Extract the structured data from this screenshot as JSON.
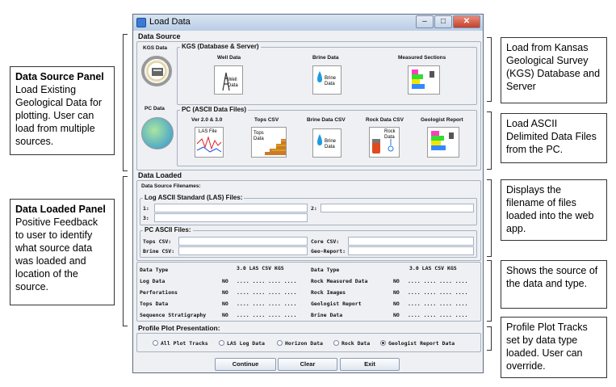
{
  "window": {
    "title": "Load Data"
  },
  "callouts": {
    "source_panel": {
      "title": "Data Source Panel",
      "body": "Load Existing Geological Data for plotting. User can load from multiple sources."
    },
    "loaded_panel": {
      "title": "Data Loaded Panel",
      "body": "Positive Feedback to user to identify what source data was loaded and location of the source."
    },
    "kgs": "Load from Kansas Geological Survey (KGS) Database and Server",
    "ascii": "Load ASCII Delimited Data Files from the PC.",
    "filenames": "Displays the filename of files loaded into the web app.",
    "source_type": "Shows the source of the data and type.",
    "tracks": "Profile Plot Tracks set by data type loaded. User can override."
  },
  "data_source": {
    "title": "Data Source",
    "kgs_label": "KGS Data",
    "kgs_group": "KGS (Database & Server)",
    "kgs_items": [
      {
        "label": "Well Data",
        "icon_text": "Well Data",
        "icon": "well-data-icon"
      },
      {
        "label": "Brine Data",
        "icon_text": "Brine Data",
        "icon": "brine-data-icon"
      },
      {
        "label": "Measured Sections",
        "icon_text": "",
        "icon": "measured-sections-icon"
      }
    ],
    "pc_label": "PC Data",
    "pc_group": "PC (ASCII Data Files)",
    "pc_items": [
      {
        "label": "Ver 2.0 & 3.0",
        "icon_text": "LAS File",
        "icon": "las-file-icon"
      },
      {
        "label": "Tops CSV",
        "icon_text": "Tops Data",
        "icon": "tops-data-icon"
      },
      {
        "label": "Brine Data CSV",
        "icon_text": "Brine Data",
        "icon": "brine-csv-icon"
      },
      {
        "label": "Rock Data CSV",
        "icon_text": "Rock Data",
        "icon": "rock-data-icon"
      },
      {
        "label": "Geologist Report",
        "icon_text": "",
        "icon": "geologist-report-icon"
      }
    ]
  },
  "data_loaded": {
    "title": "Data Loaded",
    "filenames_title": "Data Source Filenames:",
    "las_group": "Log ASCII Standard (LAS) Files:",
    "las_labels": [
      "1:",
      "2:",
      "3:"
    ],
    "pc_group": "PC ASCII Files:",
    "pc_labels": [
      "Tops CSV:",
      "Core CSV:",
      "Brine CSV:",
      "Geo-Report:"
    ]
  },
  "table": {
    "header_left": "Data Type",
    "header_right": "Data Type",
    "cols": "3.0  LAS  CSV  KGS",
    "rows_left": [
      {
        "name": "Log Data",
        "val": "NO",
        "dots": ".... .... .... ...."
      },
      {
        "name": "Perforations",
        "val": "NO",
        "dots": ".... .... .... ...."
      },
      {
        "name": "Tops Data",
        "val": "NO",
        "dots": ".... .... .... ...."
      },
      {
        "name": "Sequence Stratigraphy",
        "val": "NO",
        "dots": ".... .... .... ...."
      }
    ],
    "rows_right": [
      {
        "name": "Rock Measured Data",
        "val": "NO",
        "dots": ".... .... .... ...."
      },
      {
        "name": "Rock Images",
        "val": "NO",
        "dots": ".... .... .... ...."
      },
      {
        "name": "Geologist Report",
        "val": "NO",
        "dots": ".... .... .... ...."
      },
      {
        "name": "Brine Data",
        "val": "NO",
        "dots": ".... .... .... ...."
      }
    ]
  },
  "profile": {
    "title": "Profile Plot Presentation:",
    "options": [
      "All Plot Tracks",
      "LAS Log Data",
      "Horizon Data",
      "Rock Data",
      "Geologist Report Data"
    ],
    "selected_index": 4
  },
  "buttons": {
    "continue": "Continue",
    "clear": "Clear",
    "exit": "Exit"
  },
  "colors": {
    "titlebar": "#b9cde6",
    "window_bg": "#eef0f3",
    "close": "#c5412b"
  }
}
